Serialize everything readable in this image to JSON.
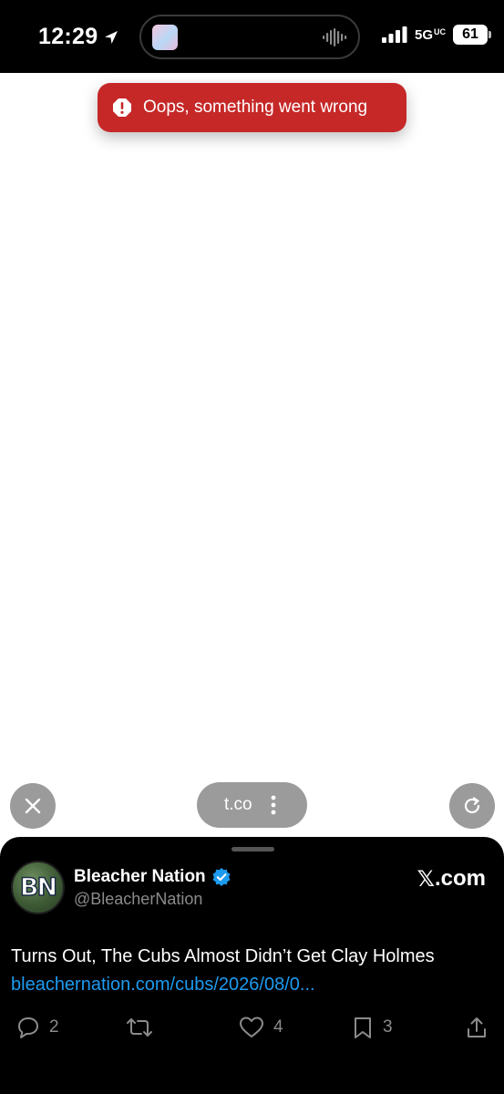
{
  "status_bar": {
    "time": "12:29",
    "network": "5G",
    "network_badge": "UC",
    "battery": "61",
    "icons": [
      "location-arrow-icon",
      "app-icon",
      "audio-wave-icon",
      "signal-icon",
      "battery-icon"
    ]
  },
  "toast": {
    "message": "Oops, something went wrong",
    "icon": "alert-icon",
    "color": "#c62828"
  },
  "browser_controls": {
    "url": "t.co",
    "close_icon": "close-icon",
    "more_icon": "more-vertical-icon",
    "reload_icon": "reload-icon"
  },
  "tweet": {
    "avatar_text": "BN",
    "display_name": "Bleacher Nation",
    "verified": true,
    "handle": "@BleacherNation",
    "source": ".com",
    "source_prefix": "𝕏",
    "headline": "Turns Out, The Cubs Almost Didn’t Get Clay Holmes",
    "link": "bleachernation.com/cubs/2026/08/0...",
    "actions": {
      "replies": "2",
      "reposts": "",
      "likes": "4",
      "bookmarks": "3"
    },
    "link_color": "#1d9bf0"
  }
}
